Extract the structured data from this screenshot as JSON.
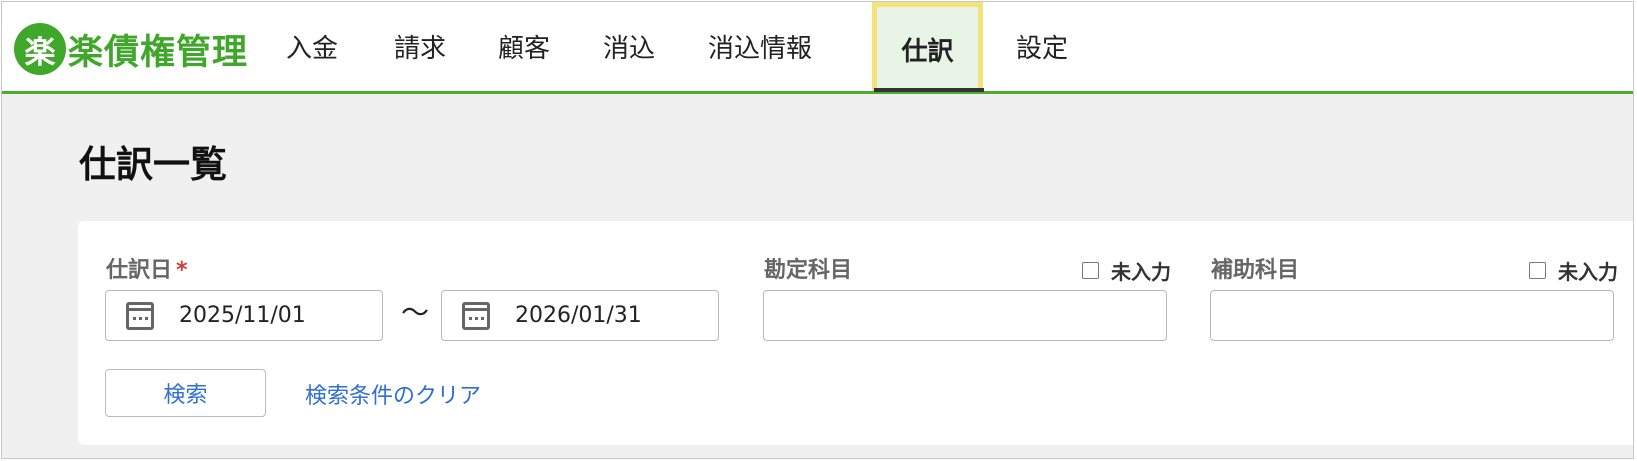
{
  "app": {
    "logo_mark": "楽",
    "logo_text": "楽債権管理"
  },
  "nav": {
    "items": [
      {
        "label": "入金"
      },
      {
        "label": "請求"
      },
      {
        "label": "顧客"
      },
      {
        "label": "消込"
      },
      {
        "label": "消込情報"
      },
      {
        "label": "仕訳"
      },
      {
        "label": "設定"
      }
    ],
    "active": "仕訳"
  },
  "page": {
    "title": "仕訳一覧"
  },
  "filters": {
    "journal_date": {
      "label": "仕訳日",
      "required_mark": "*",
      "from": "2025/11/01",
      "separator": "〜",
      "to": "2026/01/31",
      "icon": "calendar-icon"
    },
    "account": {
      "label": "勘定科目",
      "unentered_label": "未入力",
      "value": ""
    },
    "sub_account": {
      "label": "補助科目",
      "unentered_label": "未入力",
      "value": ""
    },
    "search_button": "検索",
    "clear_link": "検索条件のクリア"
  },
  "colors": {
    "brand": "#3fa72a",
    "link": "#2f6fd3",
    "required": "#d23a3a",
    "highlight": "#f4e27b"
  }
}
